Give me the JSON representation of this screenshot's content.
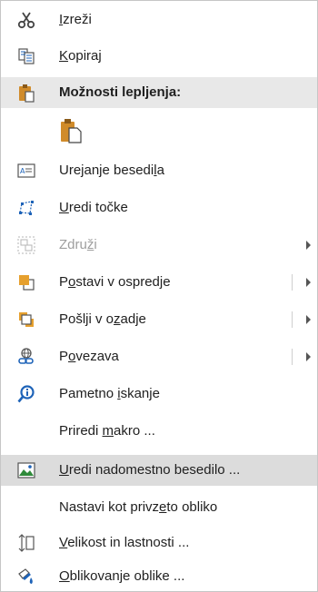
{
  "menu": {
    "items": [
      {
        "label_pre": "",
        "mnemonic": "I",
        "label_post": "zreži"
      },
      {
        "label_pre": "",
        "mnemonic": "K",
        "label_post": "opiraj"
      },
      {
        "label": "Možnosti lepljenja:"
      },
      {},
      {
        "label_pre": "Urejanje besedi",
        "mnemonic": "l",
        "label_post": "a"
      },
      {
        "label_pre": "",
        "mnemonic": "U",
        "label_post": "redi točke"
      },
      {
        "label_pre": "Zdru",
        "mnemonic": "ž",
        "label_post": "i"
      },
      {
        "label_pre": "P",
        "mnemonic": "o",
        "label_post": "stavi v ospredje"
      },
      {
        "label_pre": "Pošlji v o",
        "mnemonic": "z",
        "label_post": "adje"
      },
      {
        "label_pre": "P",
        "mnemonic": "o",
        "label_post": "vezava"
      },
      {
        "label_pre": "Pametno ",
        "mnemonic": "i",
        "label_post": "skanje"
      },
      {
        "label_pre": "Priredi ",
        "mnemonic": "m",
        "label_post": "akro ..."
      },
      {
        "label_pre": "",
        "mnemonic": "U",
        "label_post": "redi nadomestno besedilo ..."
      },
      {
        "label_pre": "Nastavi kot privz",
        "mnemonic": "e",
        "label_post": "to obliko"
      },
      {
        "label_pre": "",
        "mnemonic": "V",
        "label_post": "elikost in lastnosti ..."
      },
      {
        "label_pre": "",
        "mnemonic": "O",
        "label_post": "blikovanje oblike ..."
      }
    ]
  },
  "icons": {
    "cut": "scissors-icon",
    "copy": "copy-icon",
    "paste_header": "clipboard-icon",
    "paste_option": "paste-keep-formatting-icon",
    "edit_text": "text-box-icon",
    "edit_points": "edit-points-icon",
    "group": "group-icon",
    "front": "bring-to-front-icon",
    "back": "send-to-back-icon",
    "link": "link-icon",
    "smart_lookup": "smart-lookup-icon",
    "macro": "",
    "alt_text": "alt-text-icon",
    "default_shape": "",
    "size": "size-position-icon",
    "format": "format-shape-icon"
  },
  "colors": {
    "hover_bg": "#dcdcdc",
    "section_bg": "#e8e8e8",
    "disabled_text": "#9e9e9e",
    "accent_blue": "#1e63b8",
    "clipboard_orange": "#d08b2a"
  }
}
